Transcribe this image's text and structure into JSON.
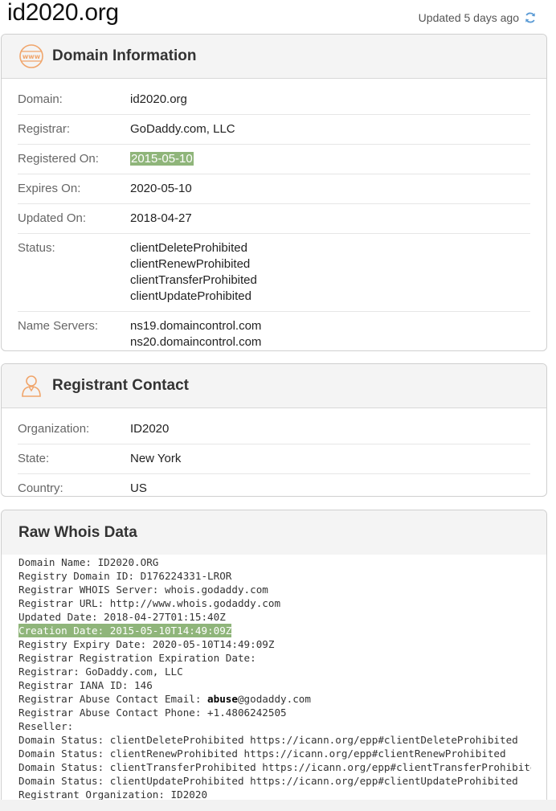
{
  "header": {
    "site_title": "id2020.org",
    "updated_text": "Updated 5 days ago"
  },
  "colors": {
    "accent_icon": "#f0a56b",
    "refresh_icon": "#5b9bd5",
    "highlight": "#8fb57a"
  },
  "domain_info": {
    "title": "Domain Information",
    "icon": "www-globe-icon",
    "rows": [
      {
        "label": "Domain:",
        "values": [
          "id2020.org"
        ]
      },
      {
        "label": "Registrar:",
        "values": [
          "GoDaddy.com, LLC"
        ]
      },
      {
        "label": "Registered On:",
        "values": [
          "2015-05-10"
        ],
        "highlight": true
      },
      {
        "label": "Expires On:",
        "values": [
          "2020-05-10"
        ]
      },
      {
        "label": "Updated On:",
        "values": [
          "2018-04-27"
        ]
      },
      {
        "label": "Status:",
        "values": [
          "clientDeleteProhibited",
          "clientRenewProhibited",
          "clientTransferProhibited",
          "clientUpdateProhibited"
        ]
      },
      {
        "label": "Name Servers:",
        "values": [
          "ns19.domaincontrol.com",
          "ns20.domaincontrol.com"
        ]
      }
    ]
  },
  "registrant": {
    "title": "Registrant Contact",
    "icon": "person-icon",
    "rows": [
      {
        "label": "Organization:",
        "values": [
          "ID2020"
        ]
      },
      {
        "label": "State:",
        "values": [
          "New York"
        ]
      },
      {
        "label": "Country:",
        "values": [
          "US"
        ]
      }
    ]
  },
  "raw_whois": {
    "title": "Raw Whois Data",
    "lines": [
      "Domain Name: ID2020.ORG",
      "Registry Domain ID: D176224331-LROR",
      "Registrar WHOIS Server: whois.godaddy.com",
      "Registrar URL: http://www.whois.godaddy.com",
      "Updated Date: 2018-04-27T01:15:40Z",
      "Creation Date: 2015-05-10T14:49:09Z",
      "Registry Expiry Date: 2020-05-10T14:49:09Z",
      "Registrar Registration Expiration Date:",
      "Registrar: GoDaddy.com, LLC",
      "Registrar IANA ID: 146",
      "Registrar Abuse Contact Email: ",
      "Registrar Abuse Contact Phone: +1.4806242505",
      "Reseller:",
      "Domain Status: clientDeleteProhibited https://icann.org/epp#clientDeleteProhibited",
      "Domain Status: clientRenewProhibited https://icann.org/epp#clientRenewProhibited",
      "Domain Status: clientTransferProhibited https://icann.org/epp#clientTransferProhibited",
      "Domain Status: clientUpdateProhibited https://icann.org/epp#clientUpdateProhibited",
      "Registrant Organization: ID2020"
    ],
    "highlight_line": "Creation Date: 2015-05-10T14:49:09Z",
    "abuse_email_user": "abuse",
    "abuse_email_domain": "@godaddy.com"
  }
}
